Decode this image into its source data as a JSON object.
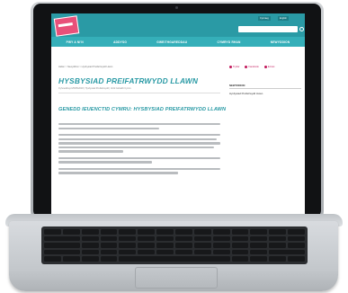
{
  "website": {
    "header": {
      "btn_1": "Cymraeg",
      "btn_2": "English",
      "search_placeholder": ""
    },
    "nav": [
      {
        "label": "PWY A NI'N"
      },
      {
        "label": "ADDYSG"
      },
      {
        "label": "GWEITHGAREDDAU"
      },
      {
        "label": "CYMRYD RHAN"
      },
      {
        "label": "NEWYDDION"
      }
    ],
    "breadcrumb": "Hafan  >  Newyddion  >  Hysbysiad Preifatrwydd Llawn",
    "share": [
      {
        "label": "Trydar"
      },
      {
        "label": "Facebook"
      },
      {
        "label": "E-bost"
      }
    ],
    "page_title": "HYSBYSIAD PREIFATRWYDD LLAWN",
    "meta": "Cyhoeddwyd 25/05/2018  |  Hysbysiad Preifatrwydd  |  Urdd Gobaith Cymru",
    "sidebar": {
      "heading": "NEWYDDION",
      "link": "Hysbysiad Preifatrwydd Llawn"
    },
    "subheading": "GENEDD IEUENCTID CYMRU: HYSBYSIAD PREIFATRWYDD LLAWN"
  }
}
